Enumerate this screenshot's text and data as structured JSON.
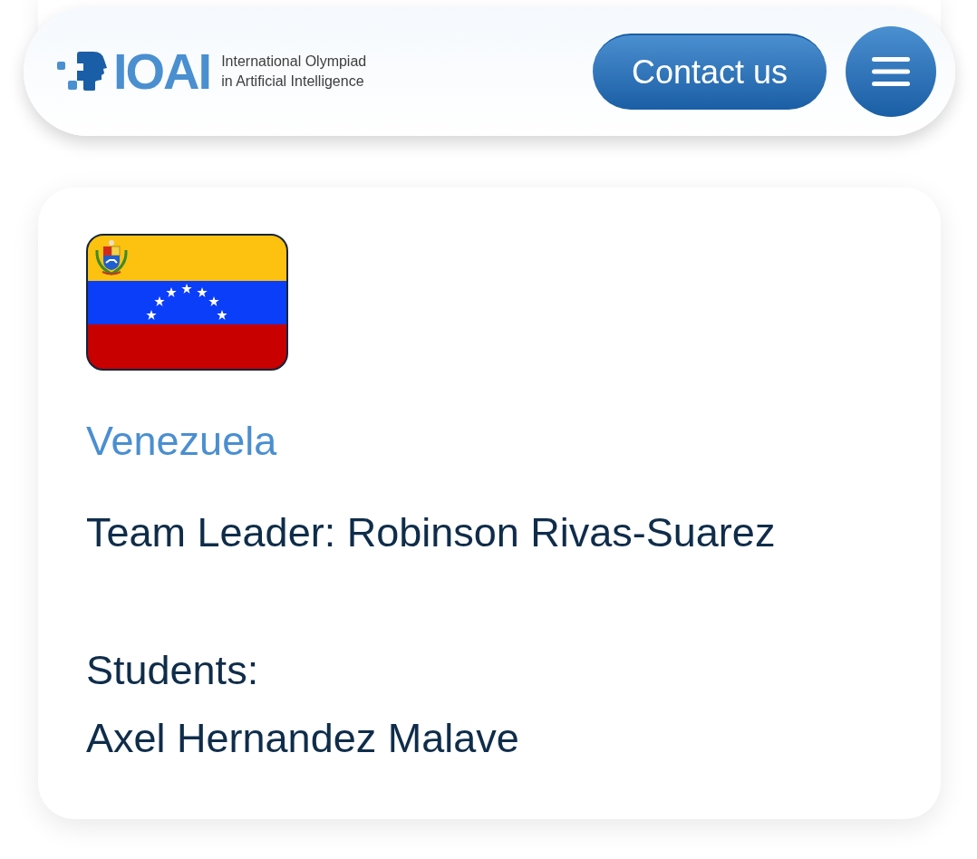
{
  "header": {
    "logo": {
      "wordmark": "IOAI",
      "tagline": [
        "International Olympiad",
        "in Artificial Intelligence"
      ]
    },
    "contact_button": "Contact us"
  },
  "team": {
    "country": "Venezuela",
    "team_leader": "Team Leader: Robinson Rivas-Suarez",
    "students_label": "Students:",
    "students": [
      "Axel Hernandez Malave"
    ]
  }
}
